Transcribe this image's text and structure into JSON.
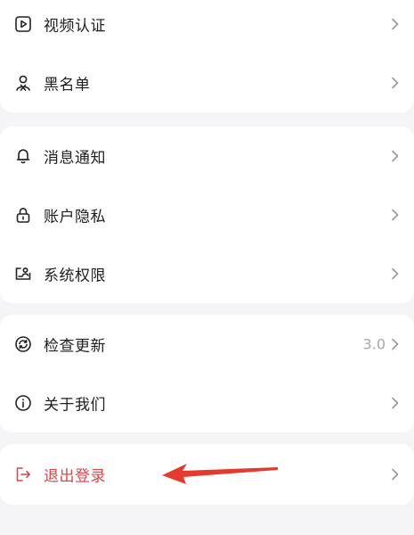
{
  "menu": {
    "group1": [
      {
        "icon": "play-square-icon",
        "label": "视频认证"
      },
      {
        "icon": "person-icon",
        "label": "黑名单"
      }
    ],
    "group2": [
      {
        "icon": "bell-icon",
        "label": "消息通知"
      },
      {
        "icon": "lock-icon",
        "label": "账户隐私"
      },
      {
        "icon": "id-card-icon",
        "label": "系统权限"
      }
    ],
    "group3": [
      {
        "icon": "refresh-icon",
        "label": "检查更新",
        "value": "3.0"
      },
      {
        "icon": "info-icon",
        "label": "关于我们"
      }
    ],
    "group4": [
      {
        "icon": "logout-icon",
        "label": "退出登录"
      }
    ]
  },
  "colors": {
    "background": "#f5f5f7",
    "card": "#ffffff",
    "text": "#1f1f1f",
    "danger": "#d6474c",
    "annotation_arrow": "#e53b2c"
  }
}
